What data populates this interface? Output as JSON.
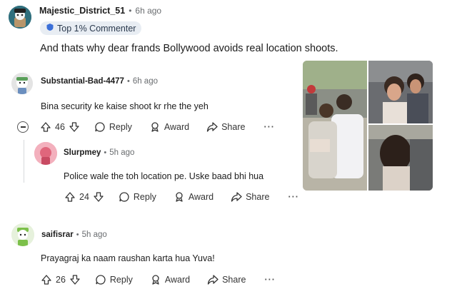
{
  "comments": [
    {
      "username": "Majestic_District_51",
      "time": "6h ago",
      "badge": "Top 1% Commenter",
      "text": "And thats why dear frands Bollywood avoids real location shoots."
    },
    {
      "username": "Substantial-Bad-4477",
      "time": "6h ago",
      "text": "Bina security ke kaise shoot kr rhe the yeh",
      "votes": "46",
      "reply_label": "Reply",
      "award_label": "Award",
      "share_label": "Share",
      "more_label": "···"
    },
    {
      "username": "Slurpmey",
      "time": "5h ago",
      "text": "Police wale the toh location pe. Uske baad bhi hua",
      "votes": "24",
      "reply_label": "Reply",
      "award_label": "Award",
      "share_label": "Share",
      "more_label": "···"
    },
    {
      "username": "saifisrar",
      "time": "5h ago",
      "text": "Prayagraj ka naam raushan karta hua Yuva!",
      "votes": "26",
      "reply_label": "Reply",
      "award_label": "Award",
      "share_label": "Share",
      "more_label": "···"
    }
  ],
  "separator": "•",
  "colors": {
    "badge_bg": "#e8edf3",
    "badge_icon": "#3b6fd8",
    "avatar_green": "#7cc04a",
    "avatar_pink": "#f1a6b4"
  }
}
